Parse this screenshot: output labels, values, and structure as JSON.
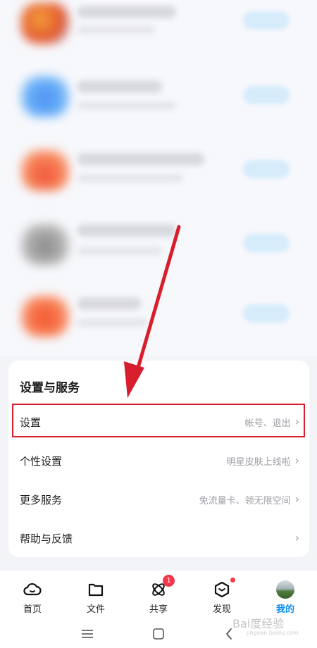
{
  "settings_card": {
    "title": "设置与服务",
    "rows": [
      {
        "label": "设置",
        "value": "帐号、退出"
      },
      {
        "label": "个性设置",
        "value": "明星皮肤上线啦"
      },
      {
        "label": "更多服务",
        "value": "免流量卡、领无限空间"
      },
      {
        "label": "帮助与反馈",
        "value": ""
      }
    ]
  },
  "tabbar": {
    "tabs": [
      {
        "label": "首页",
        "icon": "cloud-icon"
      },
      {
        "label": "文件",
        "icon": "folder-icon"
      },
      {
        "label": "共享",
        "icon": "share-orbit-icon",
        "badge": "1"
      },
      {
        "label": "发现",
        "icon": "discover-box-icon"
      },
      {
        "label": "我的",
        "icon": "avatar"
      }
    ],
    "active_tab": "我的",
    "active_color": "#0f8ff2",
    "badge_color": "#f5364a"
  },
  "annotation_color": "#d81e2c",
  "watermark": {
    "text": "Bai度经验",
    "sub": "jingyan.baidu.com"
  }
}
